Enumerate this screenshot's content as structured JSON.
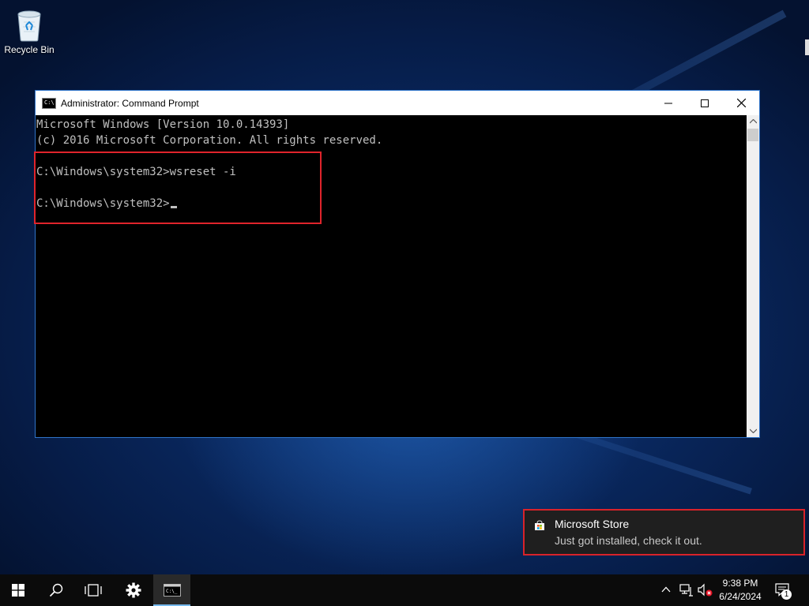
{
  "desktop": {
    "icons": [
      {
        "label": "Recycle Bin",
        "icon": "recycle-bin-icon"
      }
    ]
  },
  "window": {
    "title": "Administrator: Command Prompt",
    "console_lines": [
      "Microsoft Windows [Version 10.0.14393]",
      "(c) 2016 Microsoft Corporation. All rights reserved.",
      "",
      "C:\\Windows\\system32>wsreset -i",
      "",
      "C:\\Windows\\system32>"
    ]
  },
  "toast": {
    "app": "Microsoft Store",
    "message": "Just got installed, check it out.",
    "icon": "store-bag-icon"
  },
  "taskbar": {
    "clock_time": "9:38 PM",
    "clock_date": "6/24/2024",
    "notification_count": "1"
  },
  "colors": {
    "highlight": "#e0242b",
    "window_border": "#2f74c9",
    "console_text": "#c0c0c0"
  }
}
